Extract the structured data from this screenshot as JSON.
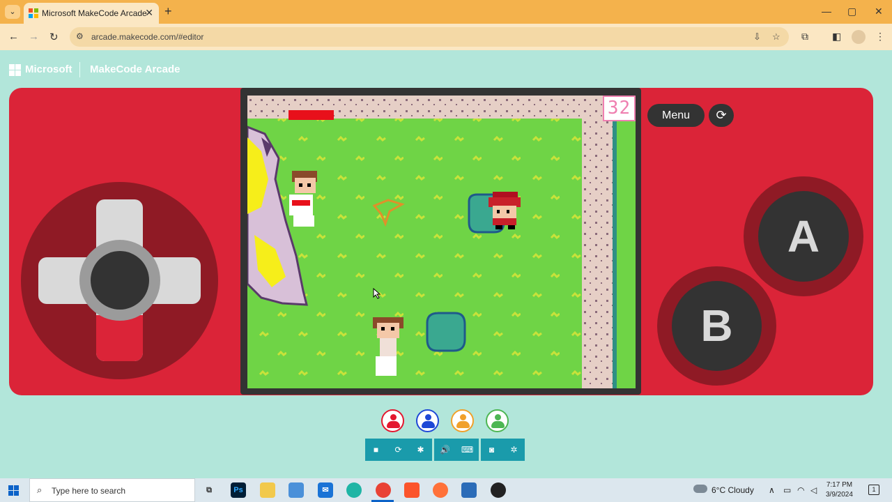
{
  "browser": {
    "tab_title": "Microsoft MakeCode Arcade",
    "tab_close": "✕",
    "new_tab": "+",
    "url": "arcade.makecode.com/#editor",
    "window_controls": [
      "—",
      "▢",
      "✕"
    ]
  },
  "header": {
    "ms_text": "Microsoft",
    "app_title": "MakeCode Arcade"
  },
  "console": {
    "menu_label": "Menu",
    "restart_label": "⟳",
    "button_a": "A",
    "button_b": "B"
  },
  "game": {
    "score": "32",
    "health_bar_color": "#e8101b"
  },
  "players": [
    {
      "color": "#e4172e"
    },
    {
      "color": "#1e48d6"
    },
    {
      "color": "#f1a02a"
    },
    {
      "color": "#4db653"
    }
  ],
  "sim_toolbar": {
    "group1": [
      "■",
      "⟳",
      "✱"
    ],
    "group2": [
      "🔊",
      "⌨"
    ],
    "group3": [
      "◙",
      "✲"
    ]
  },
  "taskbar": {
    "search_placeholder": "Type here to search",
    "weather": "6°C Cloudy",
    "time": "7:17 PM",
    "date": "3/9/2024",
    "notification_count": "1"
  }
}
